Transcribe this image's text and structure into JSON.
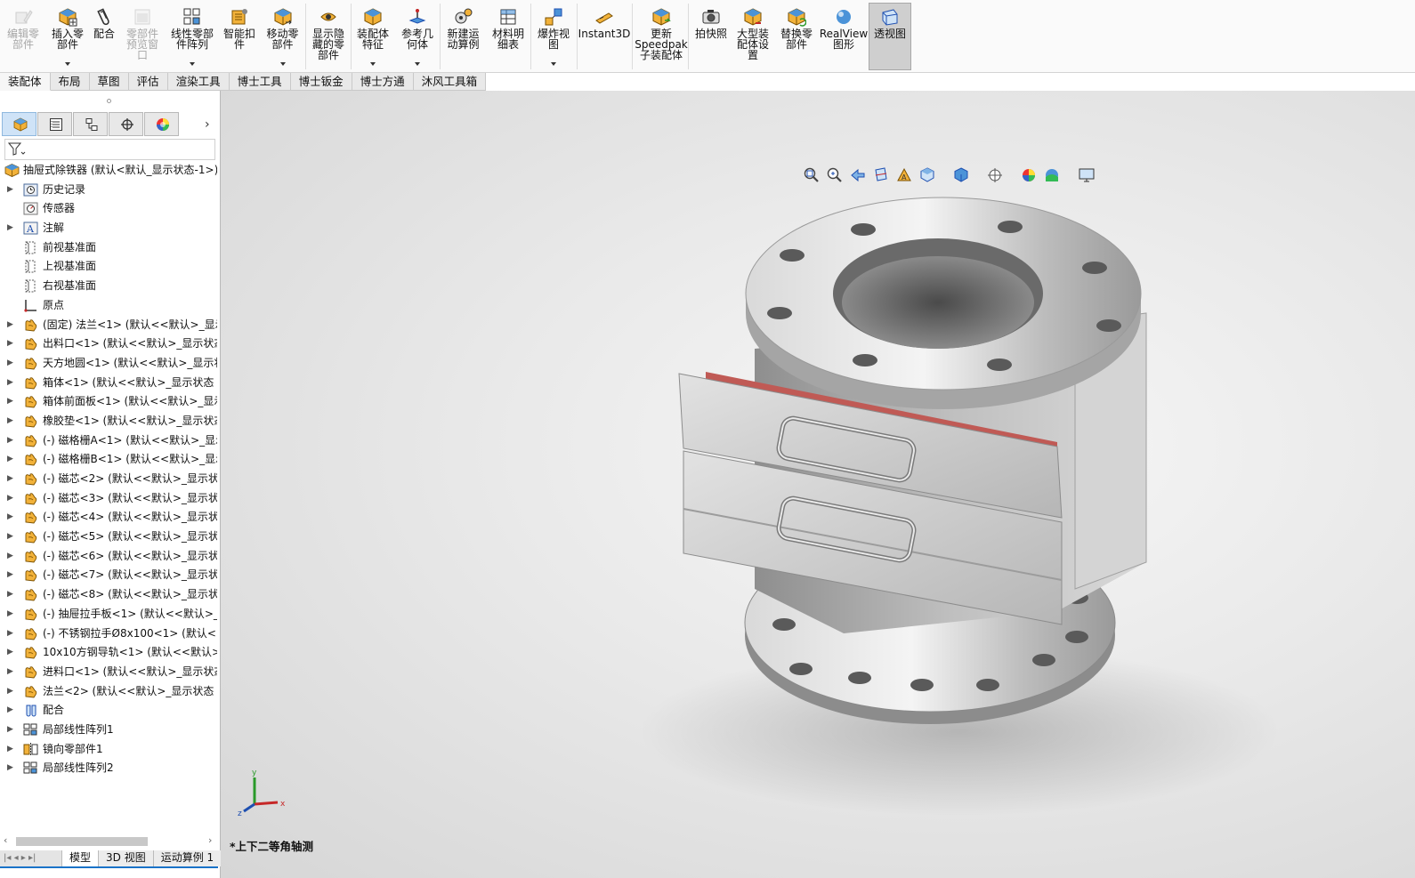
{
  "ribbon": {
    "buttons": [
      {
        "id": "edit-component",
        "label": "编辑零\n部件",
        "icon": "edit-component-icon",
        "disabled": true
      },
      {
        "id": "insert-components",
        "label": "插入零\n部件",
        "icon": "insert-components-icon",
        "dropdown": true
      },
      {
        "id": "mate",
        "label": "配合",
        "icon": "mate-icon"
      },
      {
        "id": "component-preview",
        "label": "零部件\n预览窗\n口",
        "icon": "preview-window-icon",
        "disabled": true
      },
      {
        "id": "linear-pattern",
        "label": "线性零部\n件阵列",
        "icon": "linear-pattern-icon",
        "dropdown": true
      },
      {
        "id": "smart-fasteners",
        "label": "智能扣\n件",
        "icon": "smart-fasteners-icon"
      },
      {
        "id": "move-component",
        "label": "移动零\n部件",
        "icon": "move-component-icon",
        "dropdown": true
      },
      {
        "id": "show-hidden",
        "label": "显示隐\n藏的零\n部件",
        "icon": "show-hidden-icon"
      },
      {
        "id": "assembly-features",
        "label": "装配体\n特征",
        "icon": "assembly-features-icon",
        "dropdown": true
      },
      {
        "id": "reference-geometry",
        "label": "参考几\n何体",
        "icon": "reference-geometry-icon",
        "dropdown": true
      },
      {
        "id": "new-motion-study",
        "label": "新建运\n动算例",
        "icon": "motion-study-icon"
      },
      {
        "id": "bom",
        "label": "材料明\n细表",
        "icon": "bom-icon"
      },
      {
        "id": "exploded-view",
        "label": "爆炸视\n图",
        "icon": "exploded-view-icon",
        "dropdown": true
      },
      {
        "id": "instant3d",
        "label": "Instant3D",
        "icon": "instant3d-icon"
      },
      {
        "id": "update-speedpak",
        "label": "更新\nSpeedpak\n子装配体",
        "icon": "speedpak-icon"
      },
      {
        "id": "snapshot",
        "label": "拍快照",
        "icon": "camera-icon"
      },
      {
        "id": "large-assembly",
        "label": "大型装\n配体设\n置",
        "icon": "large-assembly-icon"
      },
      {
        "id": "replace-components",
        "label": "替换零\n部件",
        "icon": "replace-components-icon"
      },
      {
        "id": "realview",
        "label": "RealView\n图形",
        "icon": "realview-icon"
      },
      {
        "id": "perspective",
        "label": "透视图",
        "icon": "perspective-icon",
        "active": true
      }
    ]
  },
  "tabs": [
    "装配体",
    "布局",
    "草图",
    "评估",
    "渲染工具",
    "博士工具",
    "博士钣金",
    "博士方通",
    "沐风工具箱"
  ],
  "tree": {
    "root": "抽屉式除铁器  (默认<默认_显示状态-1>)",
    "items": [
      {
        "label": "历史记录",
        "icon": "history-icon",
        "expand": true
      },
      {
        "label": "传感器",
        "icon": "sensor-icon",
        "expand": false
      },
      {
        "label": "注解",
        "icon": "annotation-icon",
        "expand": true
      },
      {
        "label": "前视基准面",
        "icon": "plane-icon",
        "expand": false
      },
      {
        "label": "上视基准面",
        "icon": "plane-icon",
        "expand": false
      },
      {
        "label": "右视基准面",
        "icon": "plane-icon",
        "expand": false
      },
      {
        "label": "原点",
        "icon": "origin-icon",
        "expand": false
      },
      {
        "label": "(固定) 法兰<1> (默认<<默认>_显示",
        "icon": "part-icon",
        "expand": true
      },
      {
        "label": "出料口<1> (默认<<默认>_显示状态",
        "icon": "part-icon",
        "expand": true
      },
      {
        "label": "天方地圆<1> (默认<<默认>_显示状",
        "icon": "part-icon",
        "expand": true
      },
      {
        "label": "箱体<1> (默认<<默认>_显示状态 1",
        "icon": "part-icon",
        "expand": true
      },
      {
        "label": "箱体前面板<1> (默认<<默认>_显示",
        "icon": "part-icon",
        "expand": true
      },
      {
        "label": "橡胶垫<1> (默认<<默认>_显示状态",
        "icon": "part-icon",
        "expand": true
      },
      {
        "label": "(-) 磁格栅A<1> (默认<<默认>_显示",
        "icon": "part-icon",
        "expand": true
      },
      {
        "label": "(-) 磁格栅B<1> (默认<<默认>_显示",
        "icon": "part-icon",
        "expand": true
      },
      {
        "label": "(-) 磁芯<2> (默认<<默认>_显示状态",
        "icon": "part-icon",
        "expand": true
      },
      {
        "label": "(-) 磁芯<3> (默认<<默认>_显示状态",
        "icon": "part-icon",
        "expand": true
      },
      {
        "label": "(-) 磁芯<4> (默认<<默认>_显示状态",
        "icon": "part-icon",
        "expand": true
      },
      {
        "label": "(-) 磁芯<5> (默认<<默认>_显示状态",
        "icon": "part-icon",
        "expand": true
      },
      {
        "label": "(-) 磁芯<6> (默认<<默认>_显示状态",
        "icon": "part-icon",
        "expand": true
      },
      {
        "label": "(-) 磁芯<7> (默认<<默认>_显示状态",
        "icon": "part-icon",
        "expand": true
      },
      {
        "label": "(-) 磁芯<8> (默认<<默认>_显示状态",
        "icon": "part-icon",
        "expand": true
      },
      {
        "label": "(-) 抽屉拉手板<1> (默认<<默认>_显",
        "icon": "part-icon",
        "expand": true
      },
      {
        "label": "(-) 不锈钢拉手Ø8x100<1> (默认<<默",
        "icon": "part-icon",
        "expand": true
      },
      {
        "label": "10x10方钢导轨<1> (默认<<默认>_显",
        "icon": "part-icon",
        "expand": true
      },
      {
        "label": "进料口<1> (默认<<默认>_显示状态",
        "icon": "part-icon",
        "expand": true
      },
      {
        "label": "法兰<2> (默认<<默认>_显示状态 1",
        "icon": "part-icon",
        "expand": true
      },
      {
        "label": "配合",
        "icon": "mates-folder-icon",
        "expand": true
      },
      {
        "label": "局部线性阵列1",
        "icon": "pattern-icon",
        "expand": true
      },
      {
        "label": "镜向零部件1",
        "icon": "mirror-icon",
        "expand": true
      },
      {
        "label": "局部线性阵列2",
        "icon": "pattern-icon",
        "expand": true
      }
    ]
  },
  "bottom_tabs": [
    "模型",
    "3D 视图",
    "运动算例 1"
  ],
  "viewport": {
    "view_label": "*上下二等角轴测",
    "triad": {
      "x": "x",
      "y": "y",
      "z": "z"
    }
  }
}
